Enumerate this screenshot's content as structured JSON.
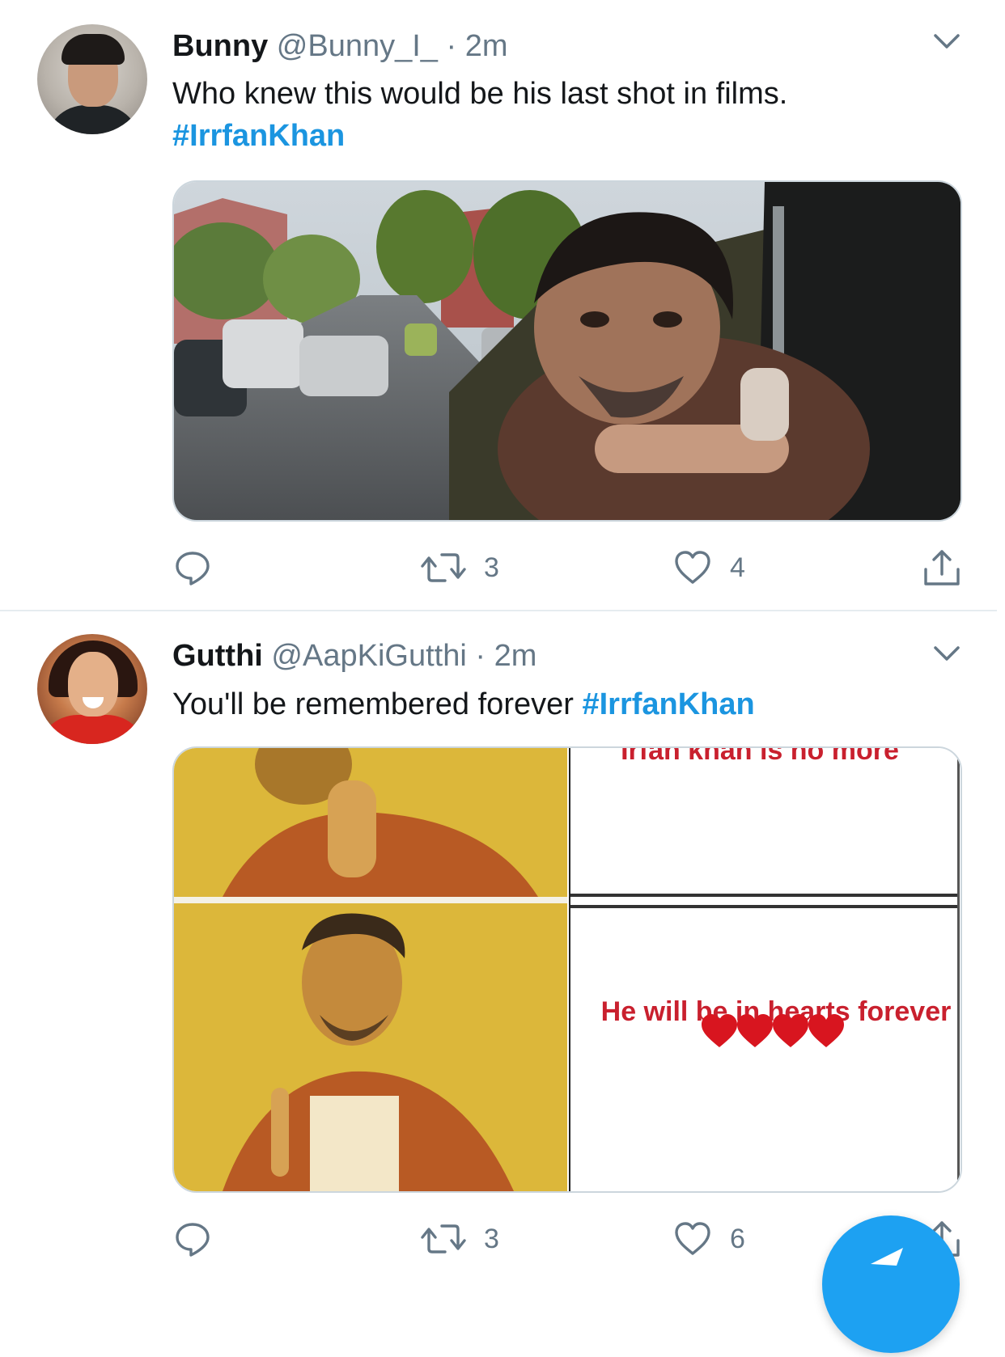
{
  "tweets": [
    {
      "name": "Bunny",
      "handle": "@Bunny_I_",
      "separator": "·",
      "time": "2m",
      "text": "Who knew this would be his last shot in films.",
      "hashtag": "#IrrfanKhan",
      "stats": {
        "retweets": "3",
        "likes": "4"
      }
    },
    {
      "name": "Gutthi",
      "handle": "@AapKiGutthi",
      "separator": "·",
      "time": "2m",
      "text": "You'll be remembered forever",
      "hashtag": "#IrrfanKhan",
      "meme": {
        "top_text": "Irfan khan is no more",
        "bottom_text": "He will be in hearts forever"
      },
      "stats": {
        "retweets": "3",
        "likes": "6"
      }
    }
  ],
  "colors": {
    "link": "#1b95e0",
    "secondary_text": "#657786",
    "primary_text": "#14171a",
    "fab": "#1da1f2",
    "border": "#ccd6dd"
  },
  "icons": {
    "reply": "reply-icon",
    "retweet": "retweet-icon",
    "like": "like-icon",
    "share": "share-icon",
    "chevron": "chevron-down-icon",
    "compose": "compose-tweet-icon"
  }
}
